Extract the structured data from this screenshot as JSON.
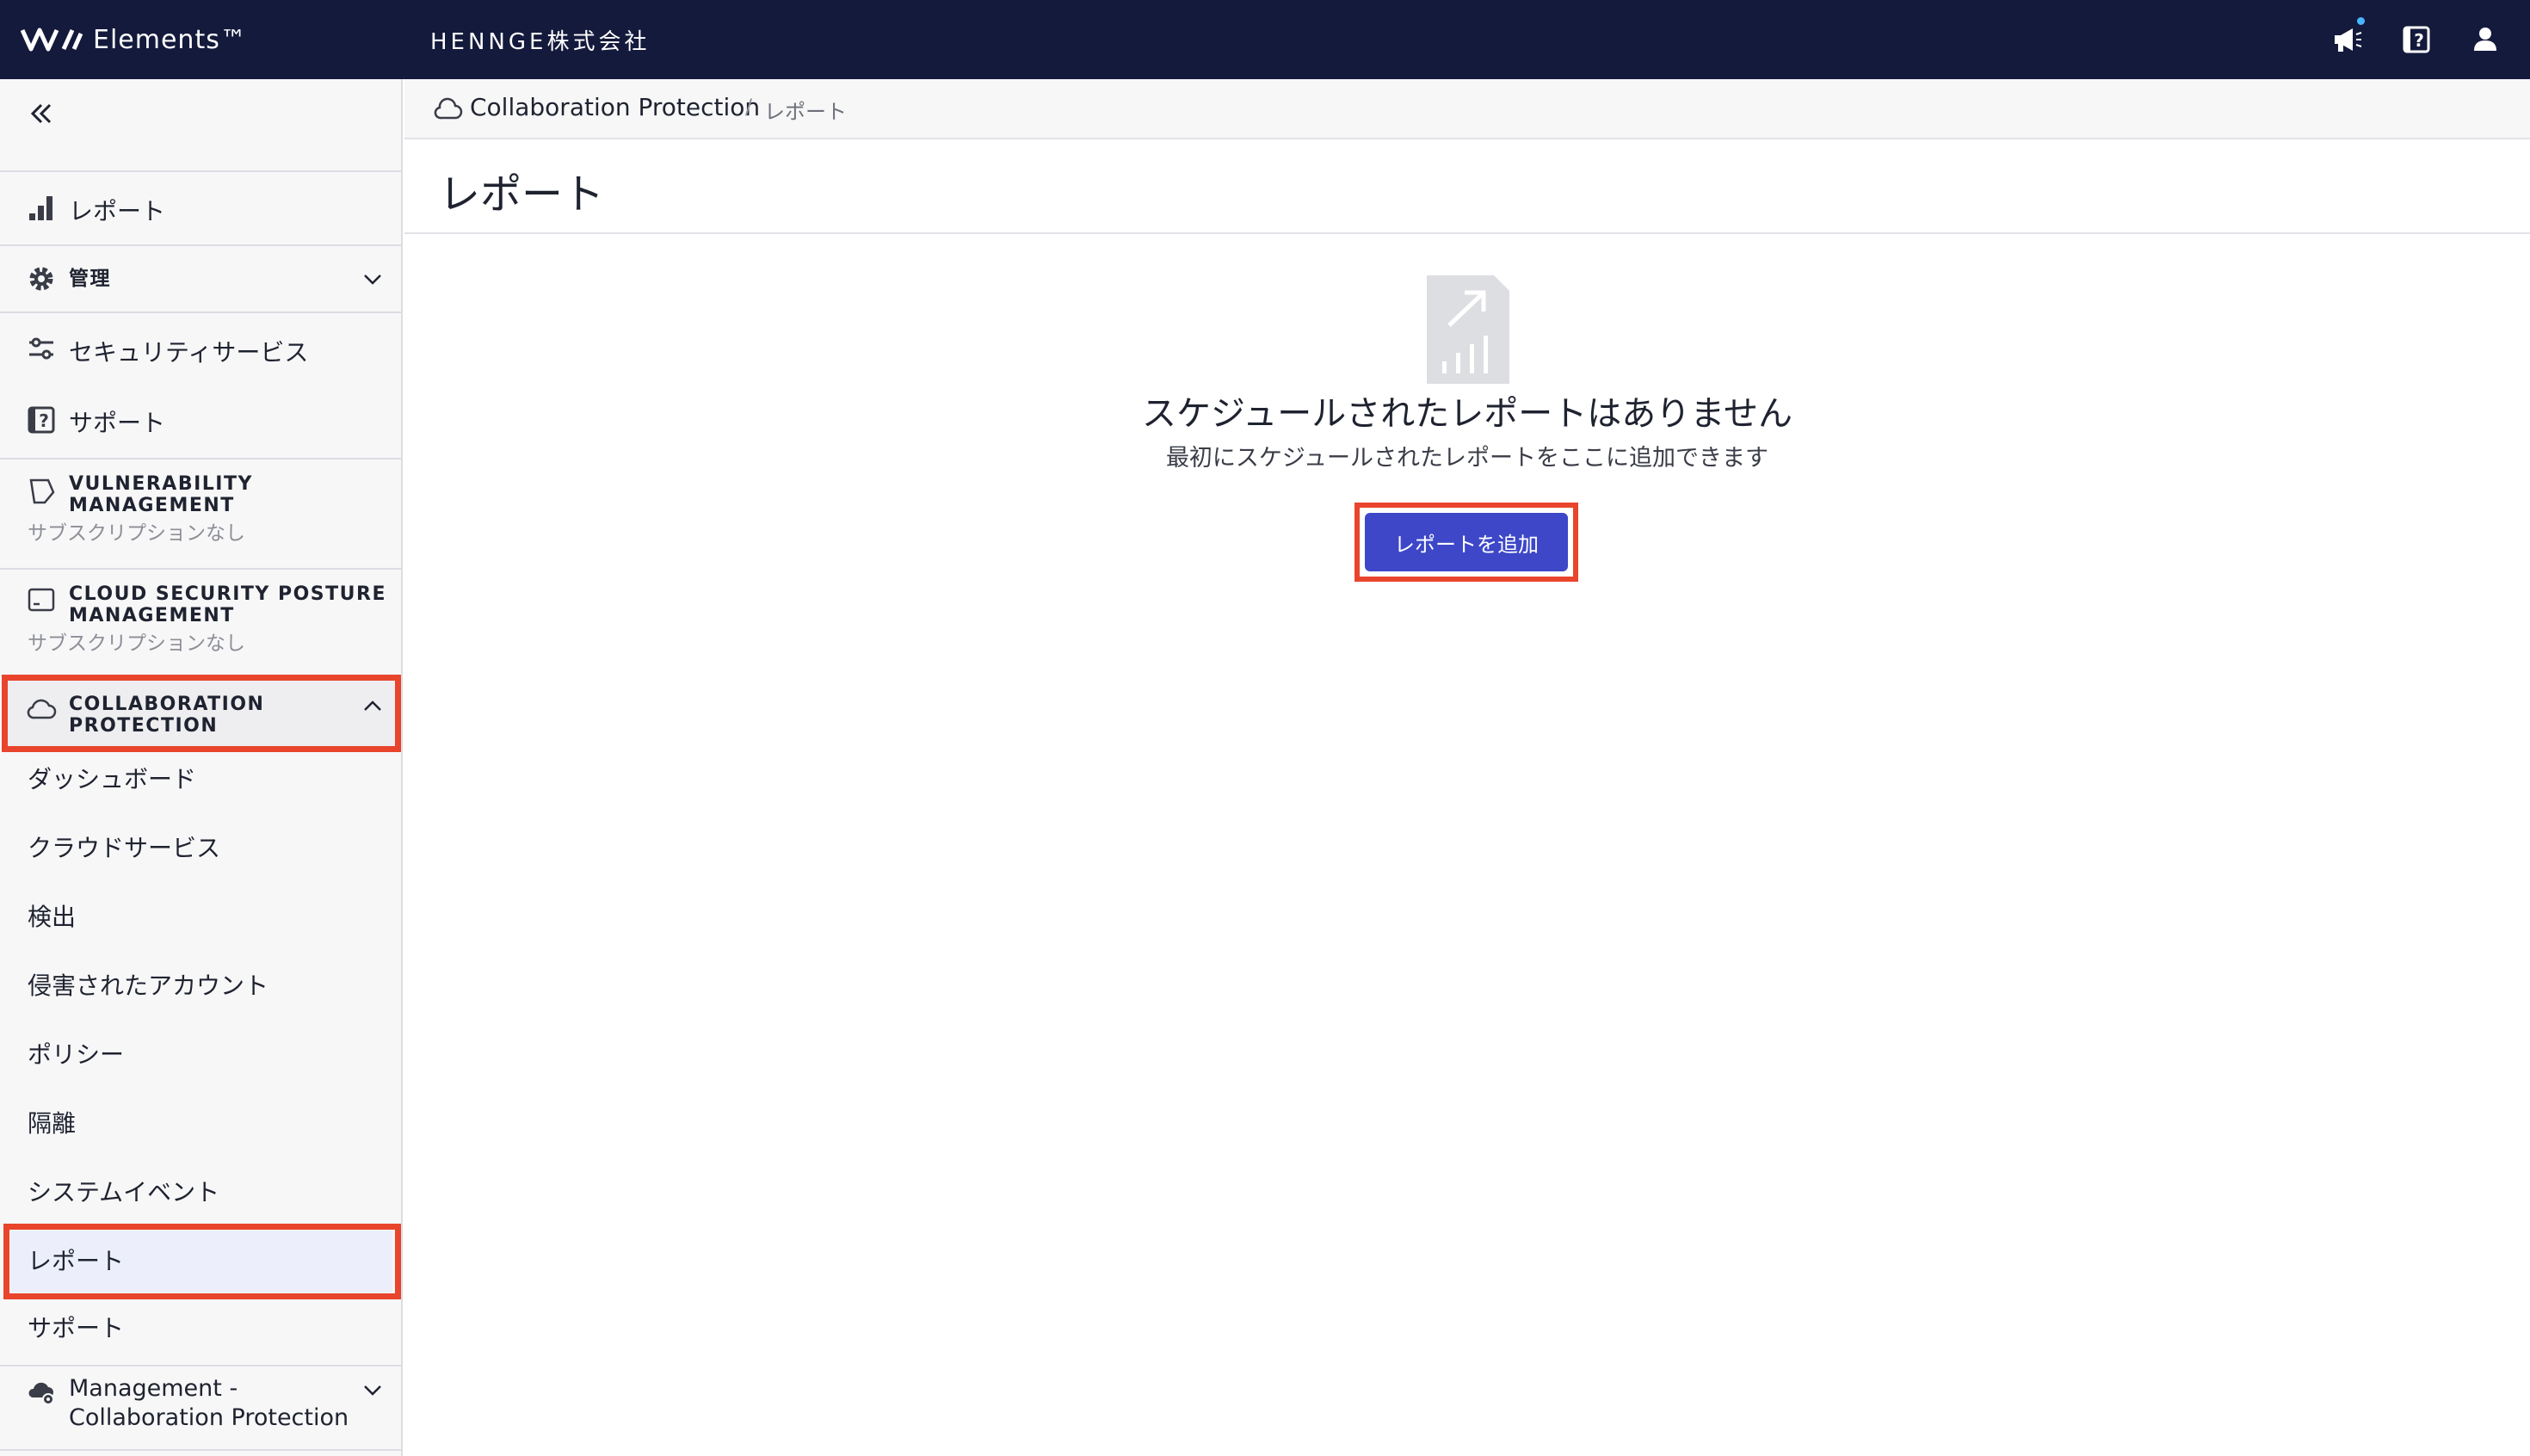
{
  "header": {
    "logo_text": "Elements™",
    "tenant": "HENNGE株式会社",
    "icons": [
      "megaphone-icon",
      "help-icon",
      "user-icon"
    ],
    "notification_dot_color": "#46b7ff"
  },
  "sidebar": {
    "reports_label": "レポート",
    "admin_label": "管理",
    "security_services_label": "セキュリティサービス",
    "support_label": "サポート",
    "vulnerability": {
      "title_line1": "VULNERABILITY",
      "title_line2": "MANAGEMENT",
      "subtitle": "サブスクリプションなし"
    },
    "cspm": {
      "title_line1": "CLOUD SECURITY POSTURE",
      "title_line2": "MANAGEMENT",
      "subtitle": "サブスクリプションなし"
    },
    "collab": {
      "title_line1": "COLLABORATION",
      "title_line2": "PROTECTION",
      "items": [
        "ダッシュボード",
        "クラウドサービス",
        "検出",
        "侵害されたアカウント",
        "ポリシー",
        "隔離",
        "システムイベント",
        "レポート",
        "サポート"
      ]
    },
    "mgmt": {
      "line1": "Management -",
      "line2": "Collaboration Protection"
    }
  },
  "breadcrumb": {
    "link": "Collaboration Protection",
    "separator": "/",
    "current": "レポート"
  },
  "main": {
    "title": "レポート",
    "empty_title": "スケジュールされたレポートはありません",
    "empty_subtitle": "最初にスケジュールされたレポートをここに追加できます",
    "add_button": "レポートを追加"
  },
  "colors": {
    "topbar": "#141a3c",
    "accent_button": "#3d47c8",
    "highlight": "#e8452c"
  }
}
